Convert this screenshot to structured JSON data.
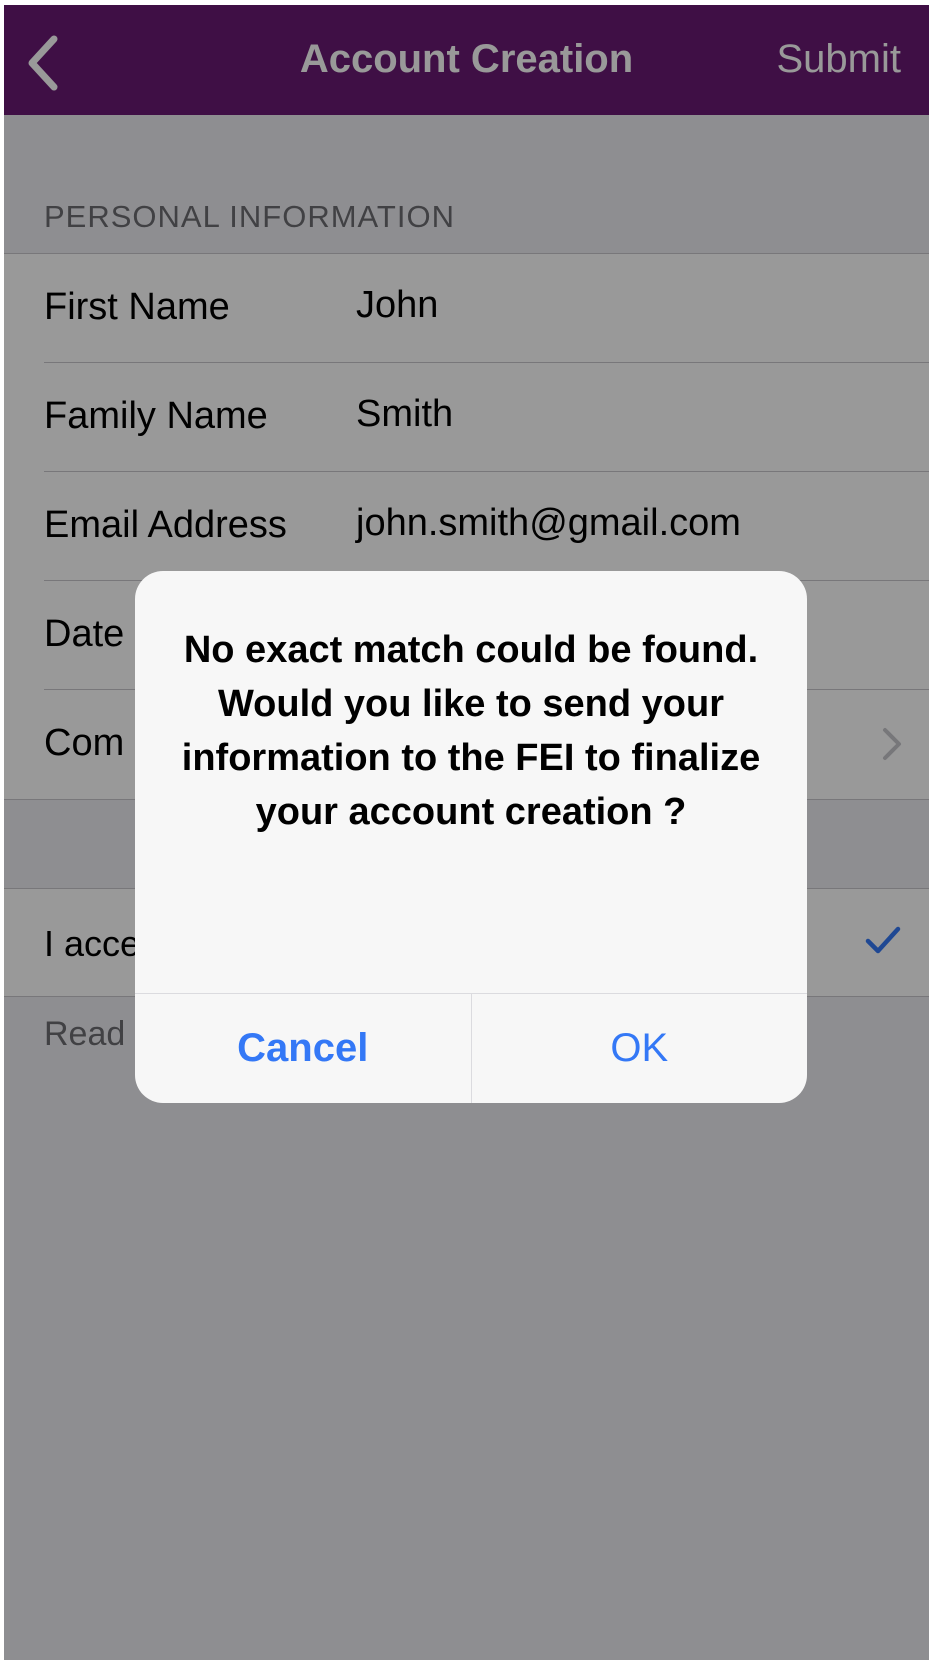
{
  "nav": {
    "back_icon": "chevron-left-icon",
    "title": "Account Creation",
    "submit_label": "Submit"
  },
  "section": {
    "header": "PERSONAL INFORMATION"
  },
  "form": {
    "rows": [
      {
        "label": "First Name",
        "value": "John"
      },
      {
        "label": "Family Name",
        "value": "Smith"
      },
      {
        "label": "Email Address",
        "value": "john.smith@gmail.com"
      },
      {
        "label": "Date",
        "value": ""
      },
      {
        "label": "Com",
        "value": "",
        "icon": "chevron-right-icon"
      }
    ]
  },
  "terms": {
    "label": "I acce",
    "check_icon": "checkmark-icon"
  },
  "read_text": "Read",
  "alert": {
    "message": "No exact match could be found.\nWould you like to send your information to the FEI to finalize your account creation ?",
    "cancel_label": "Cancel",
    "ok_label": "OK"
  },
  "colors": {
    "nav_background": "#6a1a74",
    "alert_button": "#3478f6",
    "checkmark": "#3478f6"
  }
}
